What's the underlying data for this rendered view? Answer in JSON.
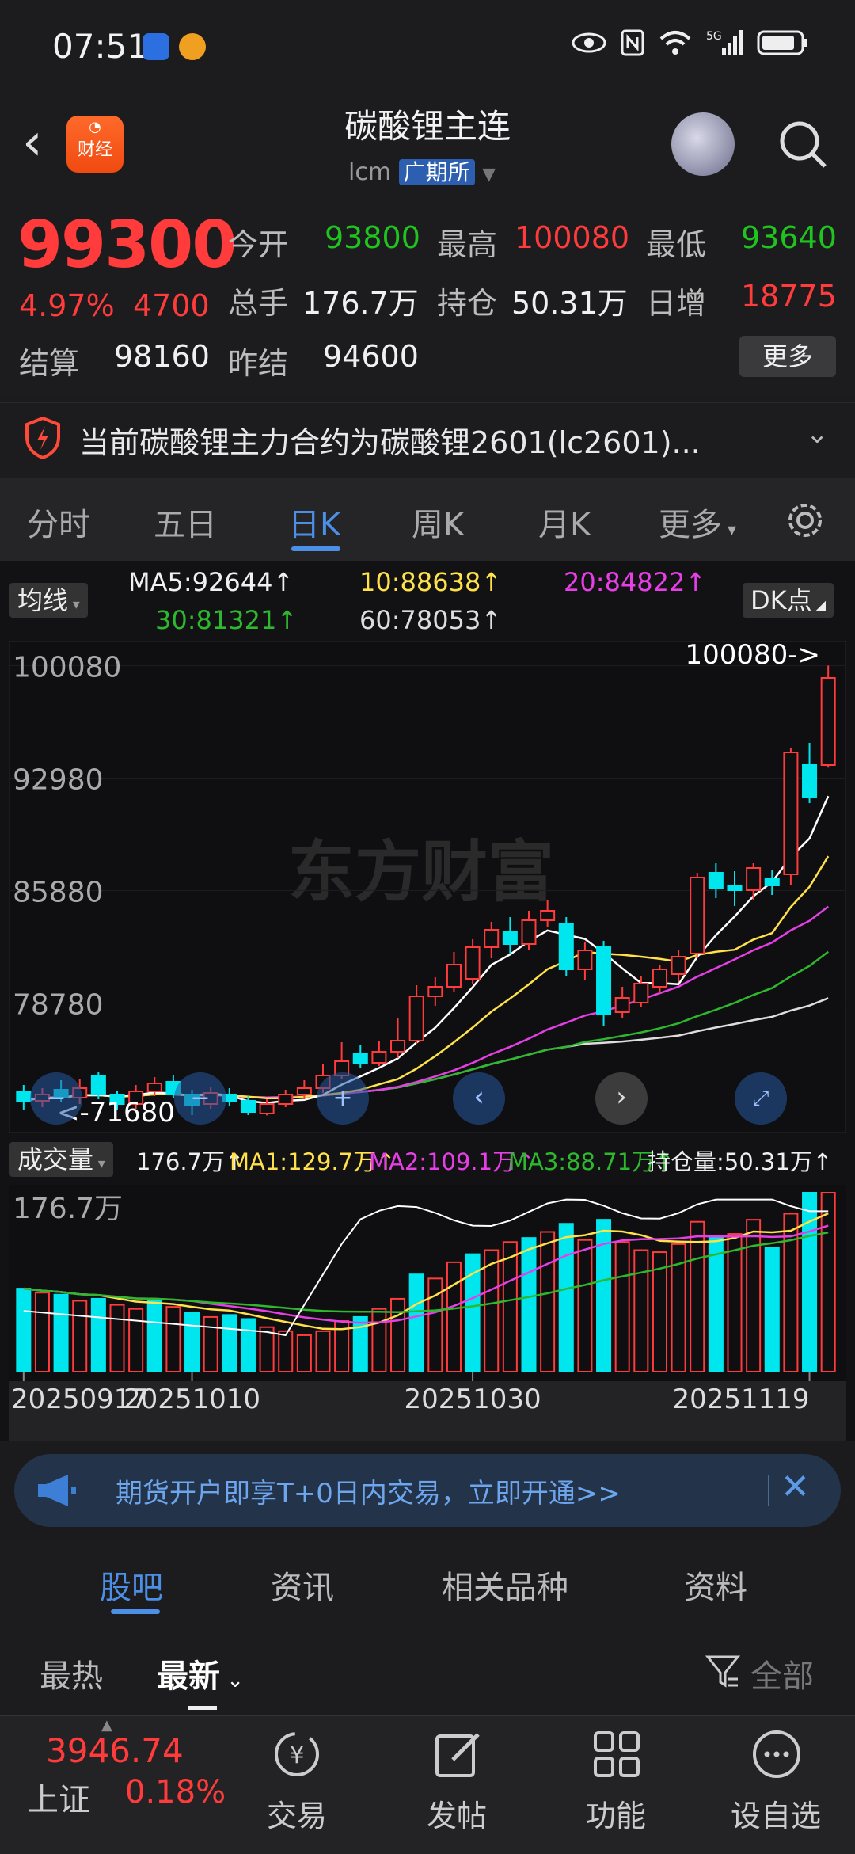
{
  "status_bar": {
    "time": "07:51"
  },
  "header": {
    "title": "碳酸锂主连",
    "code": "lcm",
    "exchange": "广期所",
    "logo_text": "财经"
  },
  "quote": {
    "price": "99300",
    "change_pct": "4.97%",
    "change": "4700",
    "open_label": "今开",
    "open": "93800",
    "high_label": "最高",
    "high": "100080",
    "low_label": "最低",
    "low": "93640",
    "volume_label": "总手",
    "volume": "176.7万",
    "position_label": "持仓",
    "position": "50.31万",
    "daily_inc_label": "日增",
    "daily_inc": "18775",
    "settle_label": "结算",
    "settle": "98160",
    "prev_settle_label": "昨结",
    "prev_settle": "94600",
    "more_button": "更多"
  },
  "notice": {
    "text": "当前碳酸锂主力合约为碳酸锂2601(lc2601)..."
  },
  "tabs": [
    "分时",
    "五日",
    "日K",
    "周K",
    "月K",
    "更多"
  ],
  "active_tab": 2,
  "ma": {
    "label": "均线",
    "ma5": "MA5:92644",
    "ma10": "10:88638",
    "ma20": "20:84822",
    "ma30": "30:81321",
    "ma60": "60:78053",
    "dk_label": "DK点"
  },
  "volume_panel": {
    "label": "成交量",
    "vol": "176.7万",
    "ma1": "MA1:129.7万",
    "ma2": "MA2:109.1万",
    "ma3": "MA3:88.71万",
    "position": "持仓量:50.31万",
    "axis_top": "176.7万"
  },
  "chart_data": {
    "type": "candlestick",
    "y_ticks": [
      "100080",
      "92980",
      "85880",
      "78780"
    ],
    "x_ticks": [
      "20250917",
      "20251010",
      "20251030",
      "20251119"
    ],
    "max_annotation": "100080->",
    "min_annotation": "71680",
    "watermark": "东方财富",
    "colors": {
      "up": "#ff3b3b",
      "down": "#00e6ee",
      "ma5": "#ffffff",
      "ma10": "#ffe14a",
      "ma20": "#e53fe5",
      "ma30": "#2db82d",
      "ma60": "#dddddd"
    },
    "candles": [
      {
        "o": 73200,
        "c": 72600,
        "h": 73600,
        "l": 72000
      },
      {
        "o": 72600,
        "c": 73000,
        "h": 73400,
        "l": 72200
      },
      {
        "o": 73300,
        "c": 72800,
        "h": 73900,
        "l": 72500
      },
      {
        "o": 72800,
        "c": 73400,
        "h": 74000,
        "l": 72400
      },
      {
        "o": 74200,
        "c": 73000,
        "h": 74400,
        "l": 72700
      },
      {
        "o": 73000,
        "c": 72400,
        "h": 73200,
        "l": 72000
      },
      {
        "o": 72400,
        "c": 73200,
        "h": 73600,
        "l": 72100
      },
      {
        "o": 73200,
        "c": 73700,
        "h": 74100,
        "l": 72900
      },
      {
        "o": 73800,
        "c": 73000,
        "h": 74200,
        "l": 72800
      },
      {
        "o": 73000,
        "c": 72300,
        "h": 73300,
        "l": 71700
      },
      {
        "o": 72400,
        "c": 73100,
        "h": 73500,
        "l": 72100
      },
      {
        "o": 73000,
        "c": 72600,
        "h": 73400,
        "l": 72300
      },
      {
        "o": 72600,
        "c": 71900,
        "h": 72900,
        "l": 71700
      },
      {
        "o": 71800,
        "c": 72400,
        "h": 72700,
        "l": 71680
      },
      {
        "o": 72400,
        "c": 73000,
        "h": 73300,
        "l": 72200
      },
      {
        "o": 73000,
        "c": 73400,
        "h": 73900,
        "l": 72700
      },
      {
        "o": 73400,
        "c": 74200,
        "h": 74900,
        "l": 73100
      },
      {
        "o": 74200,
        "c": 75100,
        "h": 76300,
        "l": 74000
      },
      {
        "o": 75600,
        "c": 75000,
        "h": 76100,
        "l": 74700
      },
      {
        "o": 75000,
        "c": 75700,
        "h": 76400,
        "l": 74800
      },
      {
        "o": 75700,
        "c": 76400,
        "h": 77800,
        "l": 75300
      },
      {
        "o": 76400,
        "c": 79200,
        "h": 79900,
        "l": 76200
      },
      {
        "o": 79200,
        "c": 79800,
        "h": 80400,
        "l": 78600
      },
      {
        "o": 79800,
        "c": 81200,
        "h": 82000,
        "l": 79500
      },
      {
        "o": 80300,
        "c": 82300,
        "h": 82800,
        "l": 80000
      },
      {
        "o": 82300,
        "c": 83400,
        "h": 83900,
        "l": 81600
      },
      {
        "o": 83300,
        "c": 82500,
        "h": 84200,
        "l": 81900
      },
      {
        "o": 82500,
        "c": 84000,
        "h": 84600,
        "l": 82100
      },
      {
        "o": 84000,
        "c": 84600,
        "h": 85300,
        "l": 83600
      },
      {
        "o": 83800,
        "c": 80900,
        "h": 84200,
        "l": 80500
      },
      {
        "o": 80900,
        "c": 82100,
        "h": 82600,
        "l": 80200
      },
      {
        "o": 82300,
        "c": 78100,
        "h": 82700,
        "l": 77300
      },
      {
        "o": 78200,
        "c": 79100,
        "h": 79800,
        "l": 77800
      },
      {
        "o": 78800,
        "c": 80000,
        "h": 80500,
        "l": 78500
      },
      {
        "o": 79800,
        "c": 80900,
        "h": 81200,
        "l": 79400
      },
      {
        "o": 80600,
        "c": 81700,
        "h": 82100,
        "l": 80100
      },
      {
        "o": 81900,
        "c": 86700,
        "h": 87000,
        "l": 81600
      },
      {
        "o": 87000,
        "c": 86000,
        "h": 87600,
        "l": 85400
      },
      {
        "o": 86200,
        "c": 85900,
        "h": 87100,
        "l": 84900
      },
      {
        "o": 85900,
        "c": 87300,
        "h": 87600,
        "l": 85300
      },
      {
        "o": 86600,
        "c": 86200,
        "h": 87200,
        "l": 85600
      },
      {
        "o": 86900,
        "c": 94600,
        "h": 94900,
        "l": 86200
      },
      {
        "o": 93800,
        "c": 91800,
        "h": 95200,
        "l": 91400
      },
      {
        "o": 93800,
        "c": 99300,
        "h": 100080,
        "l": 93640
      }
    ],
    "volume_bars": [
      {
        "v": 82,
        "up": false
      },
      {
        "v": 78,
        "up": true
      },
      {
        "v": 76,
        "up": false
      },
      {
        "v": 70,
        "up": true
      },
      {
        "v": 72,
        "up": false
      },
      {
        "v": 66,
        "up": true
      },
      {
        "v": 62,
        "up": true
      },
      {
        "v": 70,
        "up": false
      },
      {
        "v": 64,
        "up": true
      },
      {
        "v": 58,
        "up": false
      },
      {
        "v": 54,
        "up": true
      },
      {
        "v": 56,
        "up": false
      },
      {
        "v": 52,
        "up": false
      },
      {
        "v": 44,
        "up": true
      },
      {
        "v": 40,
        "up": true
      },
      {
        "v": 36,
        "up": true
      },
      {
        "v": 40,
        "up": true
      },
      {
        "v": 50,
        "up": true
      },
      {
        "v": 54,
        "up": false
      },
      {
        "v": 62,
        "up": true
      },
      {
        "v": 72,
        "up": true
      },
      {
        "v": 96,
        "up": false
      },
      {
        "v": 92,
        "up": true
      },
      {
        "v": 108,
        "up": true
      },
      {
        "v": 116,
        "up": false
      },
      {
        "v": 120,
        "up": true
      },
      {
        "v": 128,
        "up": true
      },
      {
        "v": 132,
        "up": false
      },
      {
        "v": 138,
        "up": true
      },
      {
        "v": 146,
        "up": false
      },
      {
        "v": 130,
        "up": true
      },
      {
        "v": 150,
        "up": false
      },
      {
        "v": 128,
        "up": true
      },
      {
        "v": 120,
        "up": true
      },
      {
        "v": 118,
        "up": true
      },
      {
        "v": 126,
        "up": true
      },
      {
        "v": 148,
        "up": true
      },
      {
        "v": 132,
        "up": false
      },
      {
        "v": 136,
        "up": true
      },
      {
        "v": 150,
        "up": true
      },
      {
        "v": 122,
        "up": false
      },
      {
        "v": 156,
        "up": true
      },
      {
        "v": 176.7,
        "up": false
      },
      {
        "v": 176.7,
        "up": true
      }
    ]
  },
  "banner": {
    "text": "期货开户即享T+0日内交易，立即开通>>"
  },
  "bottom_tabs": [
    "股吧",
    "资讯",
    "相关品种",
    "资料"
  ],
  "sub_tabs": {
    "hot": "最热",
    "latest": "最新",
    "filter": "全部"
  },
  "footer": {
    "index_value": "3946.74",
    "index_name": "上证",
    "index_change": "0.18%",
    "items": [
      "交易",
      "发帖",
      "功能",
      "设自选"
    ]
  }
}
